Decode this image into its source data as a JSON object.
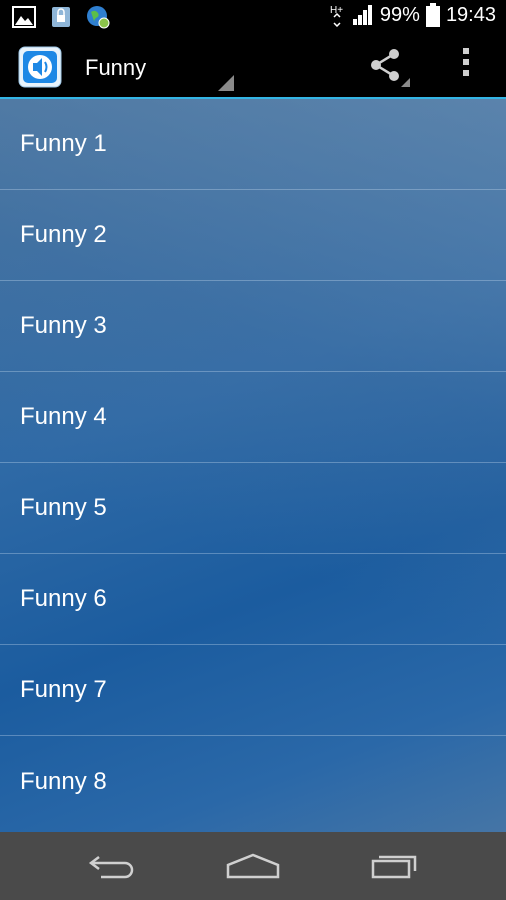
{
  "status_bar": {
    "battery": "99%",
    "time": "19:43",
    "network": "H+",
    "icons": [
      "image-icon",
      "lock-file-icon",
      "globe-sync-icon",
      "signal-icon",
      "battery-icon"
    ]
  },
  "action_bar": {
    "title": "Funny",
    "app_icon": "speaker-icon",
    "actions": [
      "share-icon",
      "overflow-menu-icon"
    ]
  },
  "list": {
    "items": [
      {
        "label": "Funny 1"
      },
      {
        "label": "Funny 2"
      },
      {
        "label": "Funny 3"
      },
      {
        "label": "Funny 4"
      },
      {
        "label": "Funny 5"
      },
      {
        "label": "Funny 6"
      },
      {
        "label": "Funny 7"
      },
      {
        "label": "Funny 8"
      }
    ]
  },
  "nav_bar": {
    "buttons": [
      "back-icon",
      "home-icon",
      "recents-icon"
    ]
  },
  "colors": {
    "accent": "#33b5e5",
    "list_background": "#2a66a3",
    "navbar": "#4a4a4a"
  }
}
